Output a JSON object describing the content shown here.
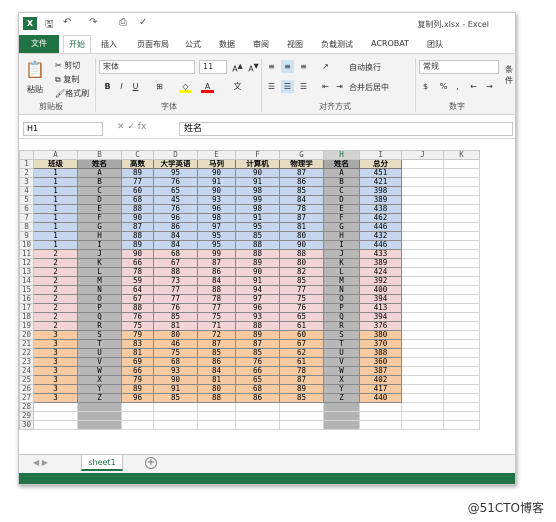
{
  "app": {
    "title": "复制列.xlsx - Excel"
  },
  "ribbon": {
    "tabs": [
      "文件",
      "开始",
      "插入",
      "页面布局",
      "公式",
      "数据",
      "审阅",
      "视图",
      "负载测试",
      "ACROBAT",
      "团队"
    ],
    "clipboard": {
      "paste": "粘贴",
      "cut": "剪切",
      "copy": "复制",
      "format_painter": "格式刷"
    },
    "font": {
      "name": "宋体",
      "size": "11"
    },
    "alignment": {
      "wrap": "自动换行",
      "merge": "合并后居中"
    },
    "number": {
      "format": "常规"
    },
    "groups": [
      "剪贴板",
      "字体",
      "对齐方式",
      "数字"
    ],
    "cond": "条件"
  },
  "formula": {
    "name_box": "H1",
    "content": "姓名"
  },
  "columns": [
    "A",
    "B",
    "C",
    "D",
    "E",
    "F",
    "G",
    "H",
    "I",
    "J",
    "K"
  ],
  "selected_column": "H",
  "headers": [
    "班级",
    "姓名",
    "高数",
    "大学英语",
    "马列",
    "计算机",
    "物理学",
    "姓名",
    "总分"
  ],
  "rows": [
    [
      "1",
      "A",
      "89",
      "95",
      "90",
      "90",
      "87",
      "A",
      "451"
    ],
    [
      "1",
      "B",
      "77",
      "76",
      "91",
      "91",
      "86",
      "B",
      "421"
    ],
    [
      "1",
      "C",
      "60",
      "65",
      "90",
      "98",
      "85",
      "C",
      "398"
    ],
    [
      "1",
      "D",
      "68",
      "45",
      "93",
      "99",
      "84",
      "D",
      "389"
    ],
    [
      "1",
      "E",
      "88",
      "76",
      "96",
      "98",
      "78",
      "E",
      "438"
    ],
    [
      "1",
      "F",
      "90",
      "96",
      "98",
      "91",
      "87",
      "F",
      "462"
    ],
    [
      "1",
      "G",
      "87",
      "86",
      "97",
      "95",
      "81",
      "G",
      "446"
    ],
    [
      "1",
      "H",
      "88",
      "84",
      "95",
      "85",
      "80",
      "H",
      "432"
    ],
    [
      "1",
      "I",
      "89",
      "84",
      "95",
      "88",
      "90",
      "I",
      "446"
    ],
    [
      "2",
      "J",
      "90",
      "68",
      "99",
      "88",
      "88",
      "J",
      "433"
    ],
    [
      "2",
      "K",
      "66",
      "67",
      "87",
      "89",
      "80",
      "K",
      "389"
    ],
    [
      "2",
      "L",
      "78",
      "88",
      "86",
      "90",
      "82",
      "L",
      "424"
    ],
    [
      "2",
      "M",
      "59",
      "73",
      "84",
      "91",
      "85",
      "M",
      "392"
    ],
    [
      "2",
      "N",
      "64",
      "77",
      "88",
      "94",
      "77",
      "N",
      "400"
    ],
    [
      "2",
      "O",
      "67",
      "77",
      "78",
      "97",
      "75",
      "O",
      "394"
    ],
    [
      "2",
      "P",
      "88",
      "76",
      "77",
      "96",
      "76",
      "P",
      "413"
    ],
    [
      "2",
      "Q",
      "76",
      "85",
      "75",
      "93",
      "65",
      "Q",
      "394"
    ],
    [
      "2",
      "R",
      "75",
      "81",
      "71",
      "88",
      "61",
      "R",
      "376"
    ],
    [
      "3",
      "S",
      "79",
      "80",
      "72",
      "89",
      "60",
      "S",
      "380"
    ],
    [
      "3",
      "T",
      "83",
      "46",
      "87",
      "87",
      "67",
      "T",
      "370"
    ],
    [
      "3",
      "U",
      "81",
      "75",
      "85",
      "85",
      "62",
      "U",
      "388"
    ],
    [
      "3",
      "V",
      "69",
      "68",
      "86",
      "76",
      "61",
      "V",
      "360"
    ],
    [
      "3",
      "W",
      "66",
      "93",
      "84",
      "66",
      "78",
      "W",
      "387"
    ],
    [
      "3",
      "X",
      "79",
      "90",
      "81",
      "65",
      "87",
      "X",
      "402"
    ],
    [
      "3",
      "Y",
      "89",
      "91",
      "80",
      "68",
      "89",
      "Y",
      "417"
    ],
    [
      "3",
      "Z",
      "96",
      "85",
      "88",
      "86",
      "85",
      "Z",
      "440"
    ]
  ],
  "empty_rows": [
    "28",
    "29",
    "30"
  ],
  "sheets": [
    "sheet1"
  ],
  "watermark": "@51CTO博客",
  "colors": {
    "class1": "#c5d6ee",
    "class2": "#f3d4d6",
    "class3": "#f8caa2",
    "header": "#e6dcc2",
    "copied_column": "#b8b8b8",
    "accent": "#217346"
  }
}
